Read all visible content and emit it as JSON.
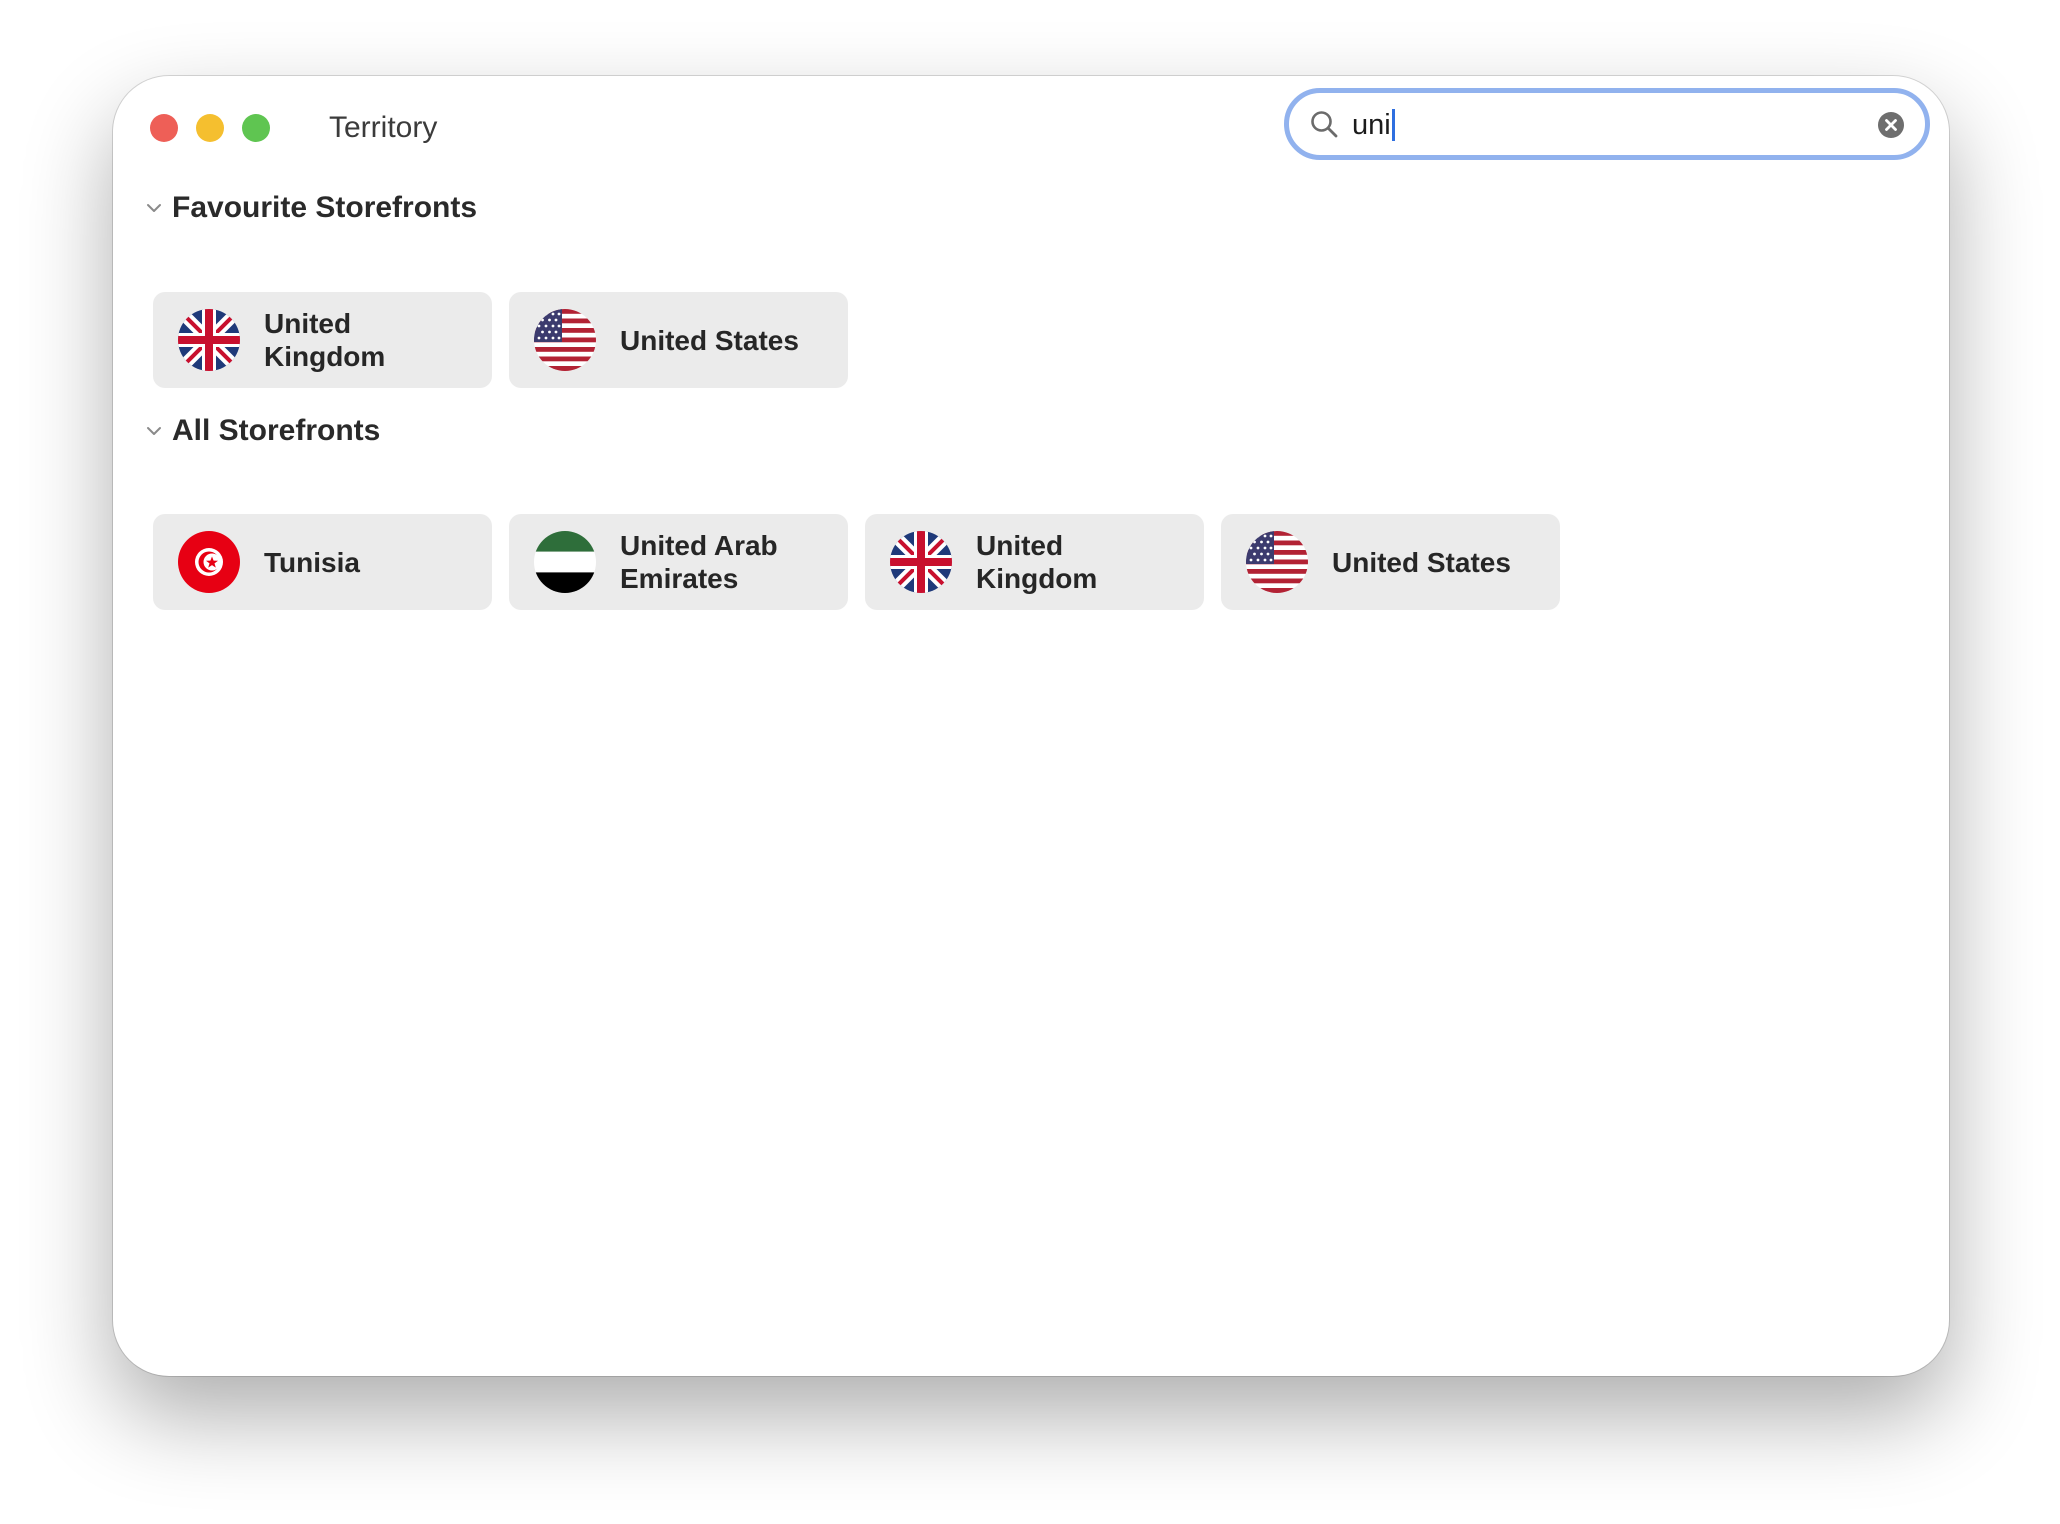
{
  "window": {
    "title": "Territory"
  },
  "search": {
    "value": "uni",
    "icon": "magnifying-glass",
    "clear_icon": "x-circle"
  },
  "sections": [
    {
      "title": "Favourite Storefronts",
      "items": [
        {
          "label": "United Kingdom",
          "flag": "gb"
        },
        {
          "label": "United States",
          "flag": "us"
        }
      ]
    },
    {
      "title": "All Storefronts",
      "items": [
        {
          "label": "Tunisia",
          "flag": "tn"
        },
        {
          "label": "United Arab Emirates",
          "flag": "ae"
        },
        {
          "label": "United Kingdom",
          "flag": "gb"
        },
        {
          "label": "United States",
          "flag": "us"
        }
      ]
    }
  ],
  "colors": {
    "close": "#ee5f57",
    "minimize": "#f5bf2f",
    "zoom": "#5fc551",
    "focus_ring": "#91b2ee",
    "tile_bg": "#ebebeb"
  }
}
